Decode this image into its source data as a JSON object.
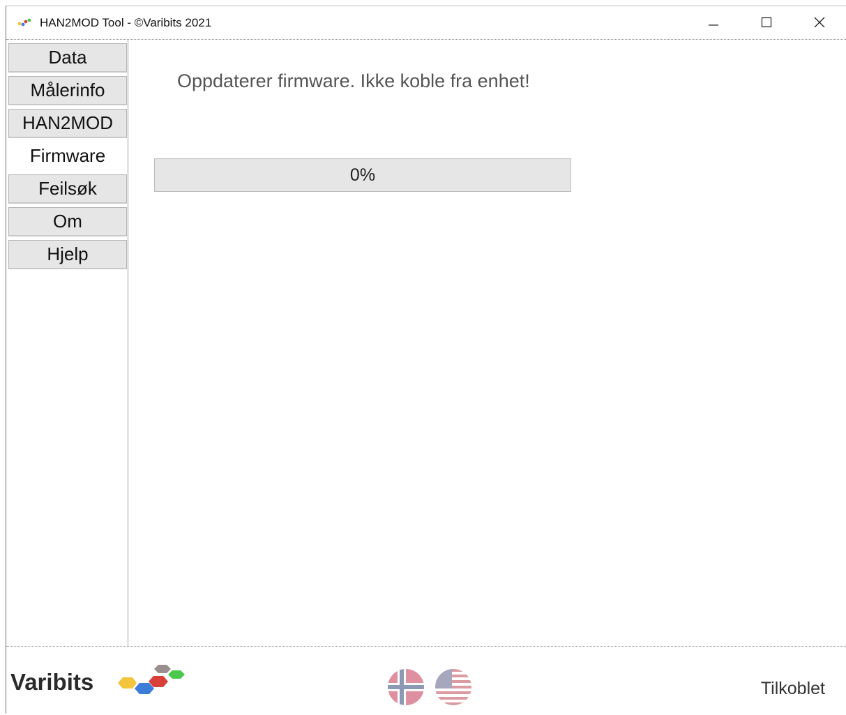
{
  "window": {
    "title": "HAN2MOD Tool - ©Varibits 2021",
    "controls": [
      "minimize-icon",
      "maximize-icon",
      "close-icon"
    ]
  },
  "sidebar": {
    "active": "Firmware",
    "tabs": [
      {
        "label": "Data"
      },
      {
        "label": "Målerinfo"
      },
      {
        "label": "HAN2MOD"
      },
      {
        "label": "Firmware"
      },
      {
        "label": "Feilsøk"
      },
      {
        "label": "Om"
      },
      {
        "label": "Hjelp"
      }
    ]
  },
  "main": {
    "status_message": "Oppdaterer firmware. Ikke koble fra enhet!",
    "progress": {
      "value_percent": 0,
      "label": "0%"
    }
  },
  "footer": {
    "brand": "Varibits",
    "languages": [
      "norwegian-flag-icon",
      "us-flag-icon"
    ],
    "connection_status": "Tilkoblet"
  },
  "colors": {
    "tab_bg": "#e6e6e6",
    "progress_fill": "#06b025",
    "hex_yellow": "#f2c53d",
    "hex_blue": "#3b7dd8",
    "hex_red": "#d8413a",
    "hex_gray": "#9a8f8f",
    "hex_green": "#4cc94c"
  }
}
